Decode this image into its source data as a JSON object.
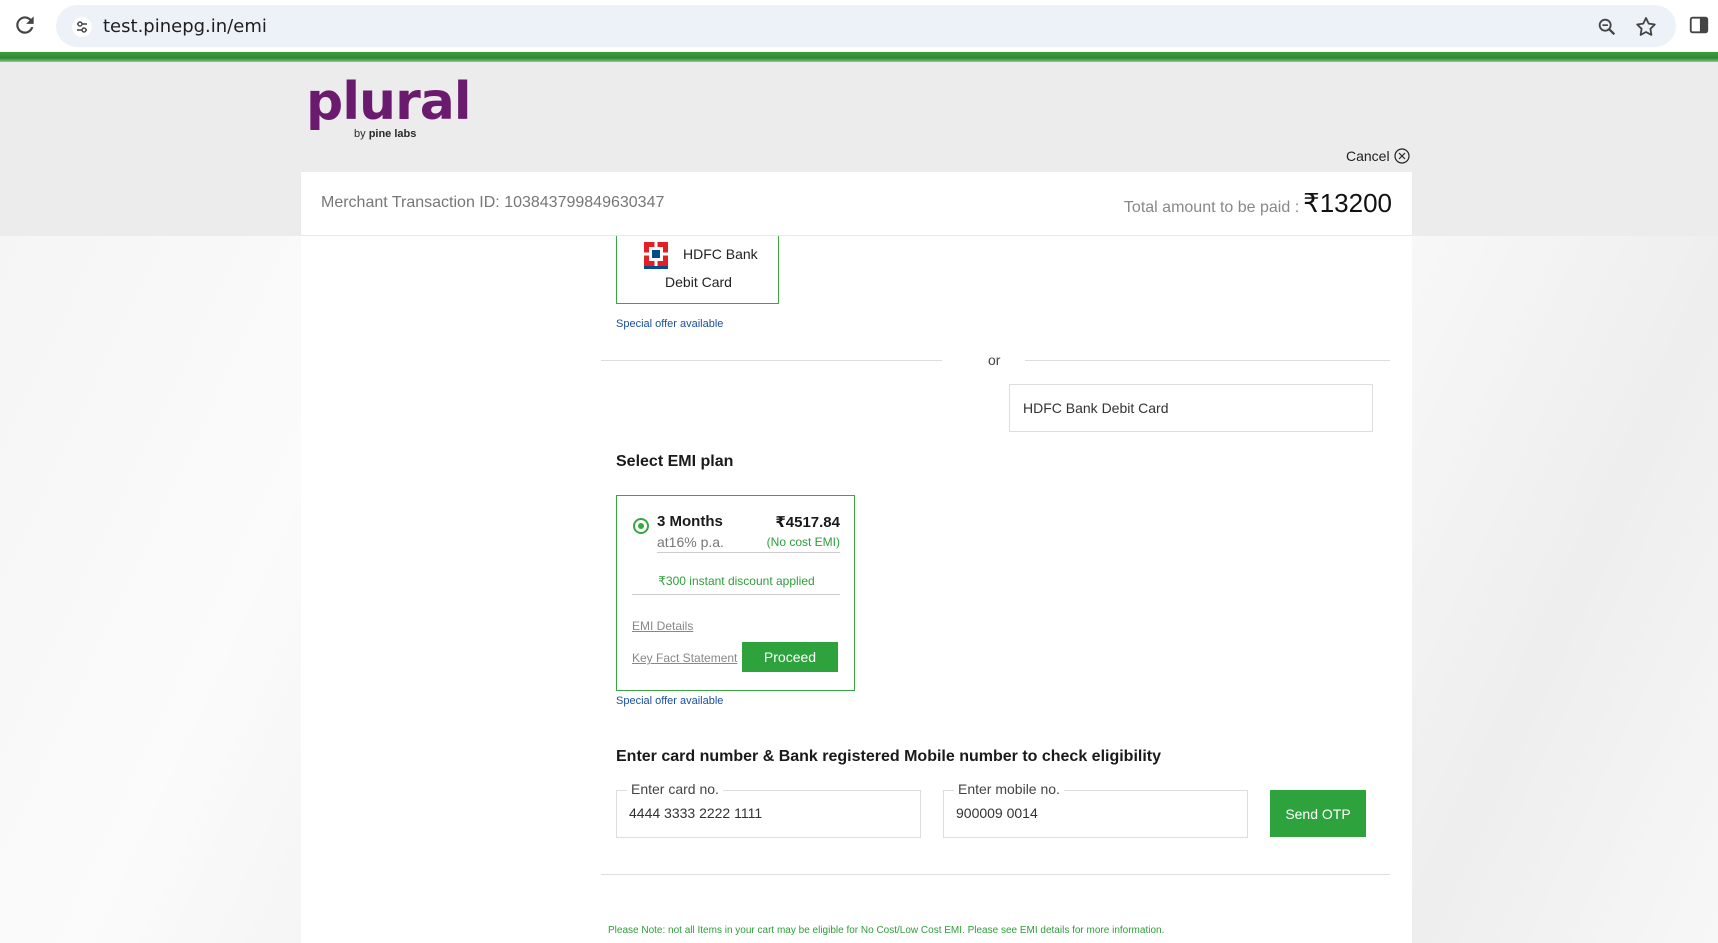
{
  "browser": {
    "url": "test.pinepg.in/emi"
  },
  "brand": {
    "logo_word": "plural",
    "by": "by",
    "company": "pine labs",
    "logo_color": "#6a1b6e"
  },
  "header": {
    "cancel_label": "Cancel",
    "merchant_txn": "Merchant Transaction ID: 103843799849630347",
    "total_label": "Total amount to be paid :",
    "total_amount": "₹13200"
  },
  "bank": {
    "name_line1": "HDFC Bank",
    "name_line2": "Debit Card",
    "special_offer": "Special offer available",
    "or_text": "or",
    "selected_bank": "HDFC Bank Debit Card"
  },
  "emi": {
    "heading": "Select EMI plan",
    "plan": {
      "months": "3 Months",
      "amount": "₹4517.84",
      "rate": "at16% p.a.",
      "tag": "(No cost EMI)",
      "discount": "₹300 instant discount applied",
      "emi_details": "EMI Details",
      "kfs": "Key Fact Statement",
      "proceed": "Proceed",
      "selected": true
    },
    "special_offer": "Special offer available"
  },
  "eligibility": {
    "heading": "Enter card number & Bank registered Mobile number to check eligibility",
    "card_label": "Enter card no.",
    "card_value": "4444 3333 2222 1111",
    "mobile_label": "Enter mobile no.",
    "mobile_value": "900009 0014",
    "send_otp": "Send OTP"
  },
  "note": "Please Note: not all Items in your cart may be eligible for No Cost/Low Cost EMI. Please see EMI details for more information.",
  "colors": {
    "accent_green": "#2ea33d",
    "link_blue": "#1a4f9c"
  }
}
